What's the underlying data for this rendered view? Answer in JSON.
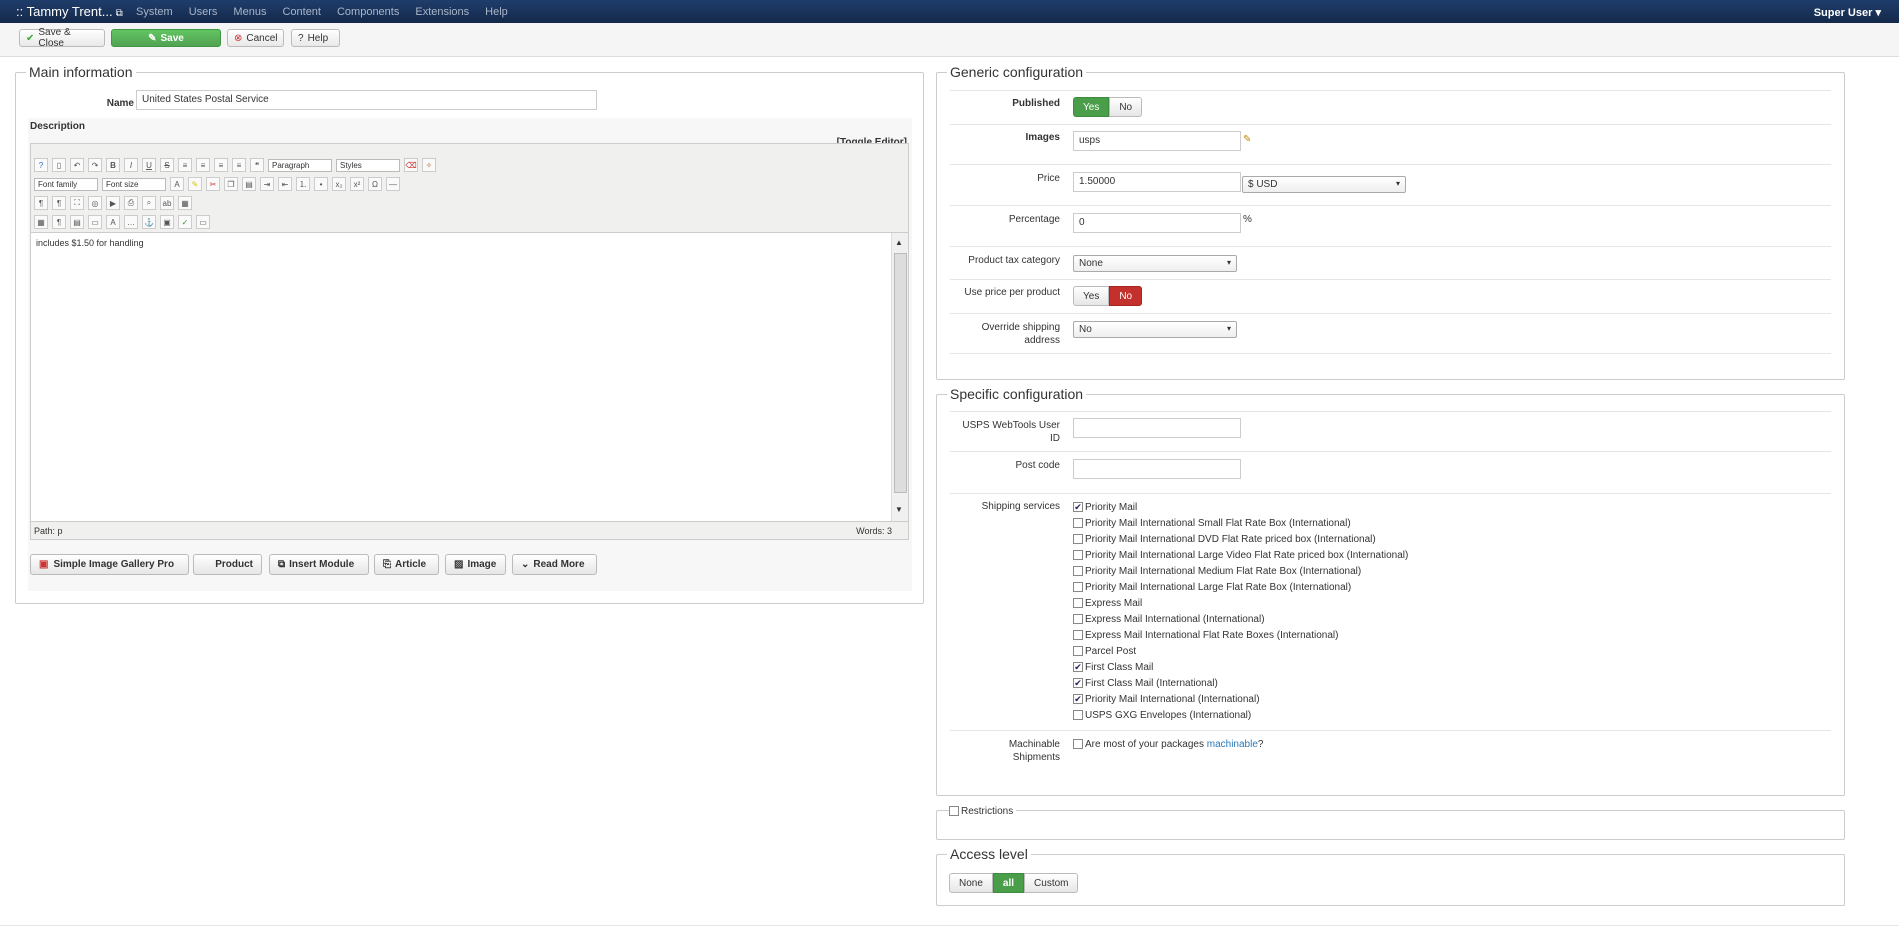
{
  "topbar": {
    "site": ":: Tammy Trent...",
    "menu": [
      "System",
      "Users",
      "Menus",
      "Content",
      "Components",
      "Extensions",
      "Help"
    ],
    "user": "Super User"
  },
  "toolbar": {
    "save_close": "Save & Close",
    "save": "Save",
    "cancel": "Cancel",
    "help": "Help"
  },
  "main": {
    "legend": "Main information",
    "name_label": "Name",
    "name_value": "United States Postal Service",
    "description_label": "Description",
    "toggle_editor": "[Toggle Editor]",
    "format_select": "Paragraph",
    "styles_select": "Styles",
    "font_family": "Font family",
    "font_size": "Font size",
    "content": "includes $1.50 for handling",
    "path": "Path: p",
    "words": "Words: 3",
    "buttons": [
      "Simple Image Gallery Pro",
      "Product",
      "Insert Module",
      "Article",
      "Image",
      "Read More"
    ]
  },
  "generic": {
    "legend": "Generic configuration",
    "published_label": "Published",
    "published_yes": "Yes",
    "published_no": "No",
    "images_label": "Images",
    "images_value": "usps",
    "price_label": "Price",
    "price_value": "1.50000",
    "currency": "$ USD",
    "percentage_label": "Percentage",
    "percentage_value": "0",
    "percent_sign": "%",
    "tax_label": "Product tax category",
    "tax_value": "None",
    "use_price_label": "Use price per product",
    "use_price_yes": "Yes",
    "use_price_no": "No",
    "override_label": "Override shipping address",
    "override_value": "No"
  },
  "specific": {
    "legend": "Specific configuration",
    "userid_label": "USPS WebTools User ID",
    "postcode_label": "Post code",
    "services_label": "Shipping services",
    "services": [
      {
        "label": "Priority Mail",
        "checked": true
      },
      {
        "label": "Priority Mail International Small Flat Rate Box (International)",
        "checked": false
      },
      {
        "label": "Priority Mail International DVD Flat Rate priced box (International)",
        "checked": false
      },
      {
        "label": "Priority Mail International Large Video Flat Rate priced box (International)",
        "checked": false
      },
      {
        "label": "Priority Mail International Medium Flat Rate Box (International)",
        "checked": false
      },
      {
        "label": "Priority Mail International Large Flat Rate Box (International)",
        "checked": false
      },
      {
        "label": "Express Mail",
        "checked": false
      },
      {
        "label": "Express Mail International (International)",
        "checked": false
      },
      {
        "label": "Express Mail International Flat Rate Boxes (International)",
        "checked": false
      },
      {
        "label": "Parcel Post",
        "checked": false
      },
      {
        "label": "First Class Mail",
        "checked": true
      },
      {
        "label": "First Class Mail (International)",
        "checked": true
      },
      {
        "label": "Priority Mail International (International)",
        "checked": true
      },
      {
        "label": "USPS GXG Envelopes (International)",
        "checked": false
      }
    ],
    "machinable_label": "Machinable Shipments",
    "machinable_text": "Are most of your packages",
    "machinable_link": "machinable",
    "machinable_q": "?"
  },
  "restrictions": {
    "label": "Restrictions"
  },
  "access": {
    "legend": "Access level",
    "none": "None",
    "all": "all",
    "custom": "Custom"
  },
  "colors": {
    "topbar": "#1a3560",
    "green": "#51a351",
    "red": "#c4302b",
    "link": "#2a7ab8"
  }
}
